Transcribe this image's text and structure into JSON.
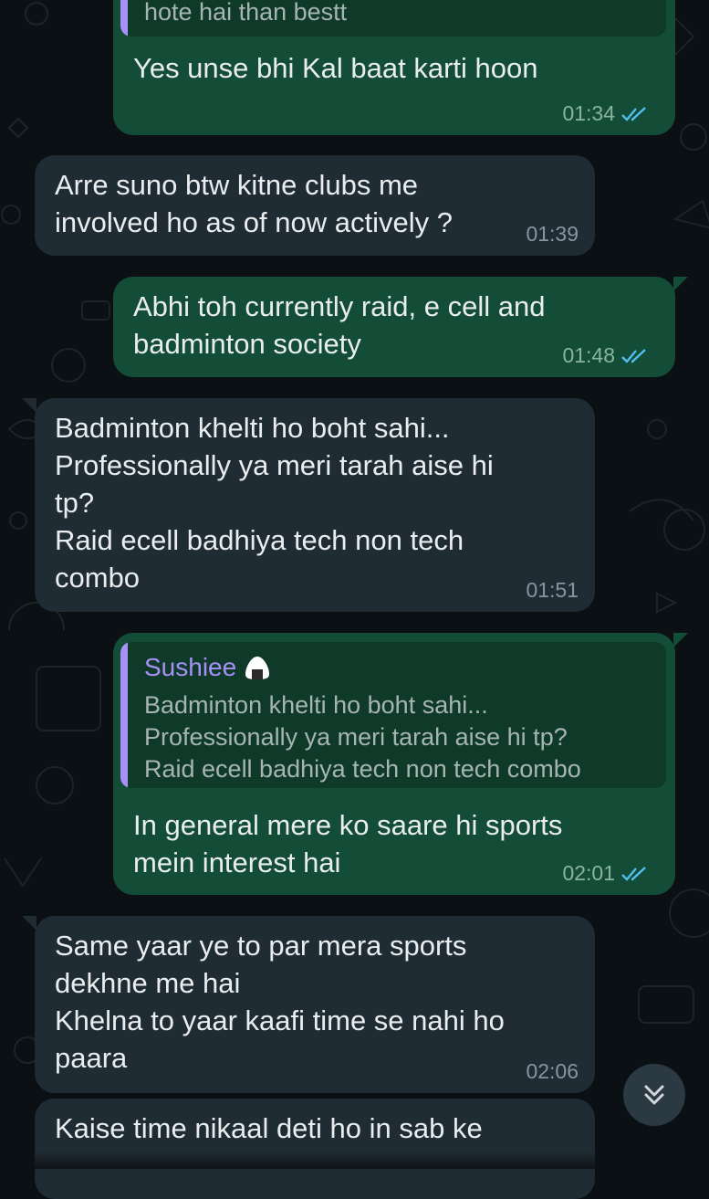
{
  "messages": [
    {
      "id": "m0",
      "direction": "out",
      "quote_text": "hote hai than bestt",
      "text": "Yes unse bhi Kal baat karti hoon",
      "time": "01:34",
      "status": "read"
    },
    {
      "id": "m1",
      "direction": "in",
      "text": "Arre suno btw kitne clubs me\ninvolved ho as of now actively ?",
      "time": "01:39"
    },
    {
      "id": "m2",
      "direction": "out",
      "text": "Abhi toh currently raid, e cell and\nbadminton society",
      "time": "01:48",
      "status": "read"
    },
    {
      "id": "m3",
      "direction": "in",
      "text": "Badminton khelti ho boht sahi...\nProfessionally ya meri tarah aise hi\ntp?\nRaid ecell badhiya tech non tech\ncombo",
      "time": "01:51"
    },
    {
      "id": "m4",
      "direction": "out",
      "quote_author": "Sushiee",
      "quote_text": "Badminton khelti ho boht sahi...\nProfessionally ya meri tarah aise hi tp?\nRaid ecell badhiya tech non tech combo",
      "text": "In general mere ko saare hi sports\nmein interest hai",
      "time": "02:01",
      "status": "read"
    },
    {
      "id": "m5",
      "direction": "in",
      "text": "Same yaar ye to par mera sports\ndekhne me hai\nKhelna to yaar kaafi time se nahi ho\npaara",
      "time": "02:06"
    },
    {
      "id": "m6",
      "direction": "in",
      "text": "Kaise time nikaal deti ho in sab ke"
    }
  ],
  "icons": {
    "read_receipt": "double-check-icon",
    "scroll_down": "double-chevron-down-icon",
    "quote_author_emoji": "rice-ball-icon"
  },
  "colors": {
    "background": "#0b1014",
    "outgoing_bubble": "#144d37",
    "incoming_bubble": "#202c33",
    "read_tick": "#53bdeb",
    "quote_accent": "#a791f7"
  }
}
